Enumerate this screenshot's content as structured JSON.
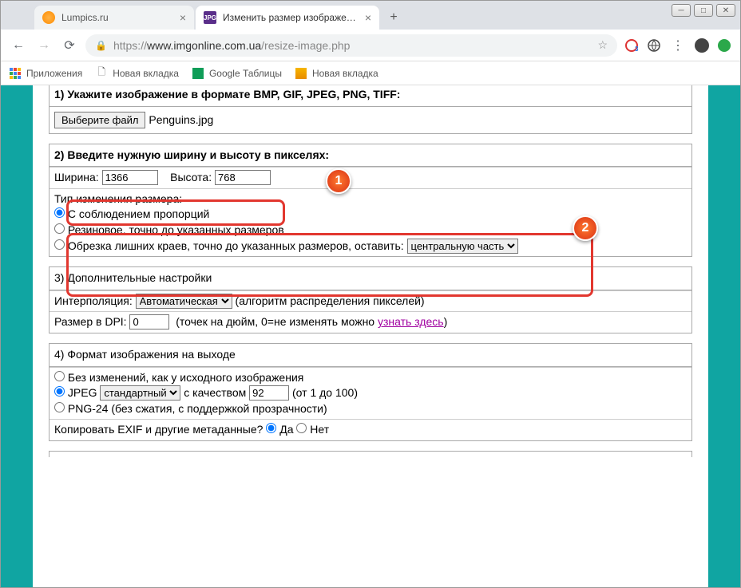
{
  "tabs": {
    "t1": "Lumpics.ru",
    "t2": "Изменить размер изображения"
  },
  "url": {
    "scheme": "https://",
    "host": "www.imgonline.com.ua",
    "path": "/resize-image.php"
  },
  "bookmarks": {
    "apps": "Приложения",
    "new1": "Новая вкладка",
    "sheets": "Google Таблицы",
    "new2": "Новая вкладка"
  },
  "step1": {
    "title": "1) Укажите изображение в формате BMP, GIF, JPEG, PNG, TIFF:",
    "btn": "Выберите файл",
    "file": "Penguins.jpg"
  },
  "step2": {
    "title": "2) Введите нужную ширину и высоту в пикселях:",
    "wlabel": "Ширина:",
    "wval": "1366",
    "hlabel": "Высота:",
    "hval": "768",
    "typeLabel": "Тип изменения размера:",
    "opt1": "С соблюдением пропорций",
    "opt2": "Резиновое, точно до указанных размеров",
    "opt3": "Обрезка лишних краев, точно до указанных размеров, оставить:",
    "cropSel": "центральную часть"
  },
  "step3": {
    "title": "3) Дополнительные настройки",
    "interpLabel": "Интерполяция:",
    "interpSel": "Автоматическая",
    "interpNote": "(алгоритм распределения пикселей)",
    "dpiLabel": "Размер в DPI:",
    "dpiVal": "0",
    "dpiNote1": "(точек на дюйм, 0=не изменять можно ",
    "dpiLink": "узнать здесь",
    "dpiNote2": ")"
  },
  "step4": {
    "title": "4) Формат изображения на выходе",
    "opt1": "Без изменений, как у исходного изображения",
    "opt2a": "JPEG ",
    "jpegSel": "стандартный",
    "opt2b": " с качеством ",
    "qVal": "92",
    "opt2c": " (от 1 до 100)",
    "opt3": "PNG-24 (без сжатия, с поддержкой прозрачности)",
    "exifLabel": "Копировать EXIF и другие метаданные? ",
    "yes": "Да ",
    "no": "Нет"
  },
  "badges": {
    "b1": "1",
    "b2": "2"
  }
}
